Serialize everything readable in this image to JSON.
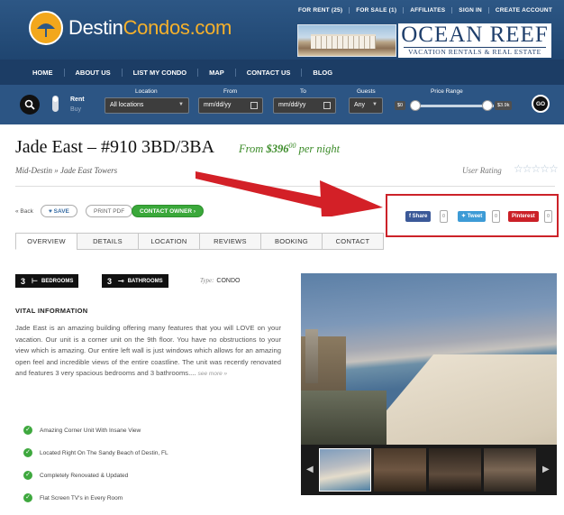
{
  "top_links": [
    "FOR RENT (25)",
    "FOR SALE (1)",
    "AFFILIATES",
    "SIGN IN",
    "CREATE ACCOUNT"
  ],
  "logo": {
    "part1": "Destin",
    "part2": "Condos.com"
  },
  "ad": {
    "brand": "OCEAN REEF",
    "tagline": "VACATION RENTALS & REAL ESTATE"
  },
  "nav": [
    "HOME",
    "ABOUT US",
    "LIST MY CONDO",
    "MAP",
    "CONTACT US",
    "BLOG"
  ],
  "search": {
    "rent": "Rent",
    "buy": "Buy",
    "location_label": "Location",
    "location_value": "All locations",
    "from_label": "From",
    "from_value": "mm/dd/yy",
    "to_label": "To",
    "to_value": "mm/dd/yy",
    "guests_label": "Guests",
    "guests_value": "Any",
    "price_label": "Price Range",
    "price_min": "$0",
    "price_max": "$3.9k",
    "go": "GO"
  },
  "listing": {
    "title": "Jade East – #910 3BD/3BA",
    "price_from": "From",
    "price": "$396",
    "price_sup": "00",
    "price_suffix": "per night",
    "breadcrumb": "Mid-Destin » Jade East Towers",
    "rating_label": "User Rating",
    "rating_stars": "☆☆☆☆☆"
  },
  "actions": {
    "back": "« Back",
    "save": "SAVE",
    "pdf": "PRINT PDF",
    "contact": "CONTACT OWNER"
  },
  "share": {
    "facebook": "Share",
    "facebook_count": "0",
    "twitter": "Tweet",
    "twitter_count": "0",
    "pinterest": "Pinterest",
    "pinterest_count": "0"
  },
  "tabs": [
    "OVERVIEW",
    "DETAILS",
    "LOCATION",
    "REVIEWS",
    "BOOKING",
    "CONTACT"
  ],
  "features": {
    "bedrooms_n": "3",
    "bedrooms_label": "BEDROOMS",
    "bathrooms_n": "3",
    "bathrooms_label": "BATHROOMS",
    "type_label": "Type:",
    "type_value": "CONDO"
  },
  "vital": {
    "heading": "VITAL INFORMATION",
    "text": "Jade East is an amazing building offering many features that you will LOVE on your vacation. Our unit is a corner unit on the 9th floor. You have no obstructions to your view which is amazing. Our entire left wall is just windows which allows for an amazing open feel and incredible views of the entire coastline. The unit was recently renovated and features 3 very spacious bedrooms and 3 bathrooms.... ",
    "more": "see more »"
  },
  "amenities": [
    "Amazing Corner Unit With Insane View",
    "Located Right On The Sandy Beach of Destin, FL",
    "Completely Renovated & Updated",
    "Flat Screen TV's in Every Room"
  ],
  "colors": {
    "header": "#2d5785",
    "accent": "#f6b12b",
    "green": "#3b8b28",
    "highlight": "#cc2229"
  }
}
